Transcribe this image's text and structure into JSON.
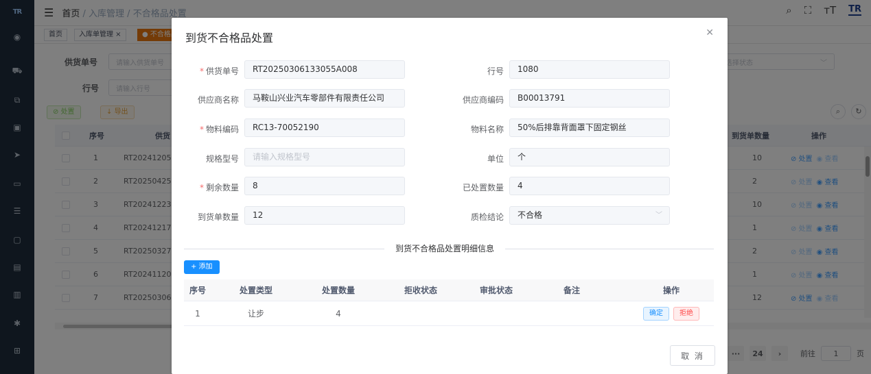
{
  "sidebar": {
    "logo": "TR"
  },
  "topbar": {
    "breadcrumbs": [
      "首页",
      "入库管理",
      "不合格品处置"
    ],
    "brand": "TR"
  },
  "tags": {
    "items": [
      "首页",
      "入库单管理",
      "不合格品"
    ]
  },
  "filters": {
    "supply_no_label": "供货单号",
    "supply_no_placeholder": "请输入供货单号",
    "line_label": "行号",
    "line_placeholder": "请输入行号",
    "status_placeholder": "选择状态"
  },
  "toolbar": {
    "handle_label": "处置",
    "export_label": "导出"
  },
  "table": {
    "headers": {
      "seq": "序号",
      "supply": "供货",
      "arrival_qty": "到货单数量",
      "ops": "操作"
    },
    "op_handle": "处置",
    "op_view": "查看",
    "rows": [
      {
        "seq": "1",
        "no": "RT20241205",
        "qty": "10"
      },
      {
        "seq": "2",
        "no": "RT20250425",
        "qty": "2"
      },
      {
        "seq": "3",
        "no": "RT20241223",
        "qty": "10"
      },
      {
        "seq": "4",
        "no": "RT20241217",
        "qty": "1"
      },
      {
        "seq": "5",
        "no": "RT20250327",
        "qty": "2"
      },
      {
        "seq": "6",
        "no": "RT20241120",
        "qty": "1"
      },
      {
        "seq": "7",
        "no": "RT20250306",
        "qty": "12"
      }
    ]
  },
  "pager": {
    "ellipsis": "···",
    "last_page": "24",
    "goto_label": "前往",
    "goto_value": "1",
    "page_unit": "页"
  },
  "dialog": {
    "title": "到货不合格品处置",
    "fields": {
      "supply_no_label": "供货单号",
      "supply_no": "RT20250306133055A008",
      "line_no_label": "行号",
      "line_no": "1080",
      "supplier_name_label": "供应商名称",
      "supplier_name": "马鞍山兴业汽车零部件有限责任公司",
      "supplier_code_label": "供应商编码",
      "supplier_code": "B00013791",
      "material_code_label": "物料编码",
      "material_code": "RC13-70052190",
      "material_name_label": "物料名称",
      "material_name": "50%后排靠背面罩下固定钢丝",
      "spec_label": "规格型号",
      "spec_placeholder": "请输入规格型号",
      "unit_label": "单位",
      "unit": "个",
      "remaining_label": "剩余数量",
      "remaining": "8",
      "handled_label": "已处置数量",
      "handled": "4",
      "arrival_qty_label": "到货单数量",
      "arrival_qty": "12",
      "qc_label": "质检结论",
      "qc": "不合格"
    },
    "detail_title": "到货不合格品处置明细信息",
    "add_label": "+ 添加",
    "detail_headers": [
      "序号",
      "处置类型",
      "处置数量",
      "拒收状态",
      "审批状态",
      "备注",
      "操作"
    ],
    "detail_rows": [
      {
        "seq": "1",
        "type": "让步",
        "qty": "4",
        "reject": "",
        "approve": "",
        "remark": ""
      }
    ],
    "confirm_label": "确定",
    "reject_label": "拒绝",
    "cancel_label": "取 消"
  }
}
